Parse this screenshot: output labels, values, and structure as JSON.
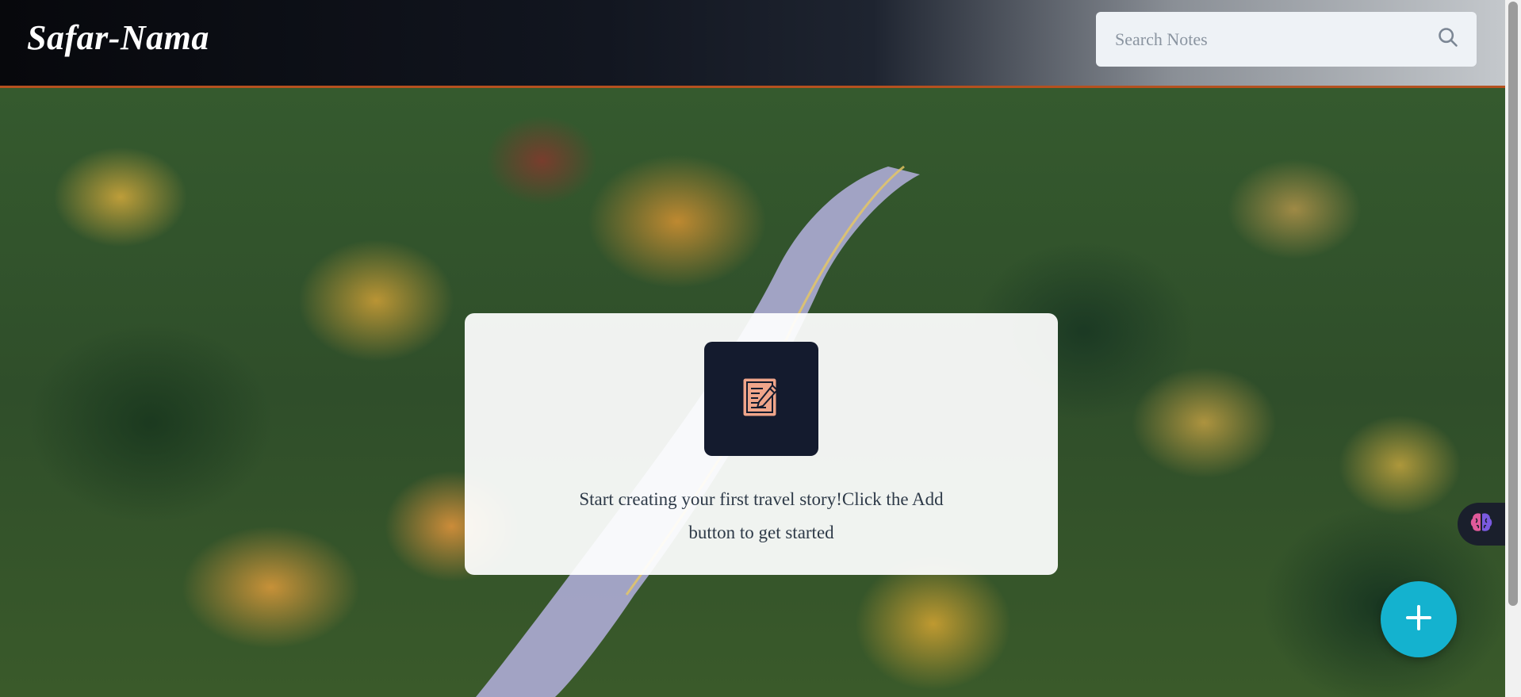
{
  "app": {
    "title": "Safar-Nama"
  },
  "search": {
    "placeholder": "Search Notes",
    "icon": "search-icon"
  },
  "empty_state": {
    "icon": "notepad-pen-icon",
    "message": "Start creating your first travel story!Click the Add button to get started"
  },
  "fab": {
    "icon": "plus-icon",
    "color": "#14b2cf"
  },
  "widget": {
    "icon": "brain-icon"
  },
  "colors": {
    "header_border": "#b5511f",
    "card_icon_bg": "#141b2e",
    "card_icon_fg": "#f0a58a"
  }
}
